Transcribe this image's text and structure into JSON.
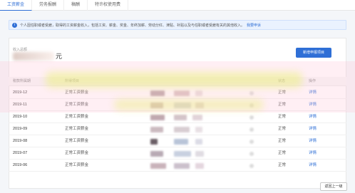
{
  "tabs": [
    {
      "label": "工资薪金"
    },
    {
      "label": "劳务报酬"
    },
    {
      "label": "稿酬"
    },
    {
      "label": "特许权使用费"
    }
  ],
  "notice": {
    "text": "个人因任职或者受雇，取得的工资薪金收入，包括工资、薪金、奖金、年终加薪、劳动分红、津贴、补贴以及与任职或者受雇有关的其他收入。",
    "link": "我要申诉"
  },
  "summary": {
    "label": "收入总额",
    "unit": "元"
  },
  "add_button": "新增申报项目",
  "table": {
    "headers": [
      "税款所属期",
      "所得项目",
      "",
      "",
      "",
      "状态",
      "操作"
    ],
    "rows": [
      {
        "period": "2019-12",
        "type": "正常工资薪金",
        "status": "正常",
        "action": "详情"
      },
      {
        "period": "2019-11",
        "type": "正常工资薪金",
        "status": "正常",
        "action": "详情"
      },
      {
        "period": "2019-10",
        "type": "正常工资薪金",
        "status": "正常",
        "action": "详情"
      },
      {
        "period": "2019-09",
        "type": "正常工资薪金",
        "status": "正常",
        "action": "详情"
      },
      {
        "period": "2019-08",
        "type": "正常工资薪金",
        "status": "正常",
        "action": "详情"
      },
      {
        "period": "2019-07",
        "type": "正常工资薪金",
        "status": "正常",
        "action": "详情"
      },
      {
        "period": "2019-06",
        "type": "正常工资薪金",
        "status": "正常",
        "action": "详情"
      }
    ]
  },
  "pager": {
    "prev": "返回上一级"
  },
  "colors": {
    "accent": "#2f6fd6",
    "banner": "#ffc4d6",
    "notice_bg": "#eaf2fe"
  }
}
